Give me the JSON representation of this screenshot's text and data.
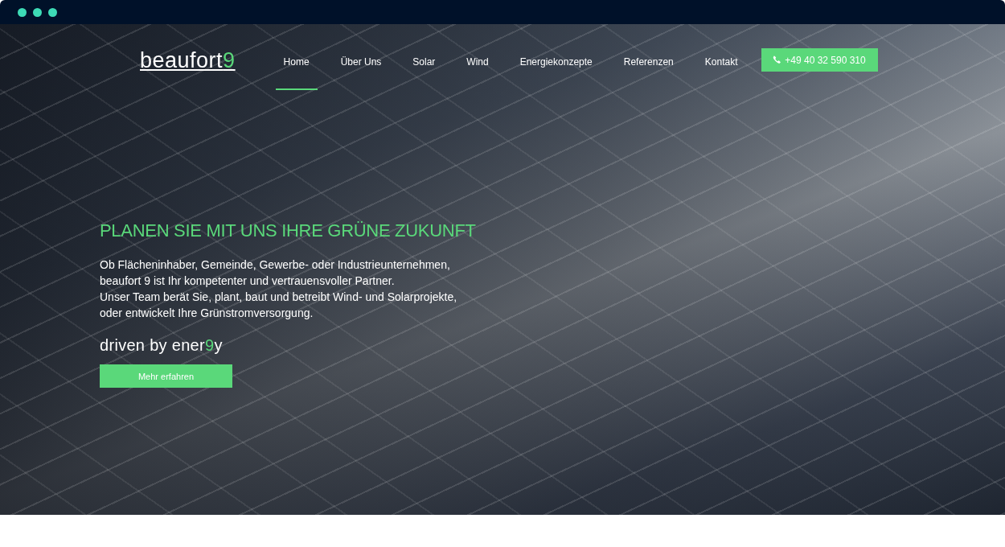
{
  "logo": {
    "text": "beaufort",
    "accent": "9"
  },
  "nav": [
    {
      "label": "Home",
      "selected": true
    },
    {
      "label": "Über Uns",
      "selected": false
    },
    {
      "label": "Solar",
      "selected": false
    },
    {
      "label": "Wind",
      "selected": false
    },
    {
      "label": "Energiekonzepte",
      "selected": false
    },
    {
      "label": "Referenzen",
      "selected": false
    },
    {
      "label": "Kontakt",
      "selected": false
    }
  ],
  "phone_button": "+49 40 32 590 310",
  "hero": {
    "heading": "PLANEN SIE MIT UNS IHRE GRÜNE ZUKUNFT",
    "lines": [
      "Ob Flächeninhaber, Gemeinde, Gewerbe- oder Industrieunternehmen,",
      "beaufort 9 ist Ihr kompetenter und vertrauensvoller Partner.",
      "Unser Team berät Sie, plant, baut und betreibt Wind- und Solarprojekte,",
      "oder entwickelt Ihre Grünstromversorgung."
    ],
    "tagline": {
      "text": "driven by ener",
      "accent": "9",
      "tail": "y"
    },
    "button": "Mehr erfahren"
  }
}
